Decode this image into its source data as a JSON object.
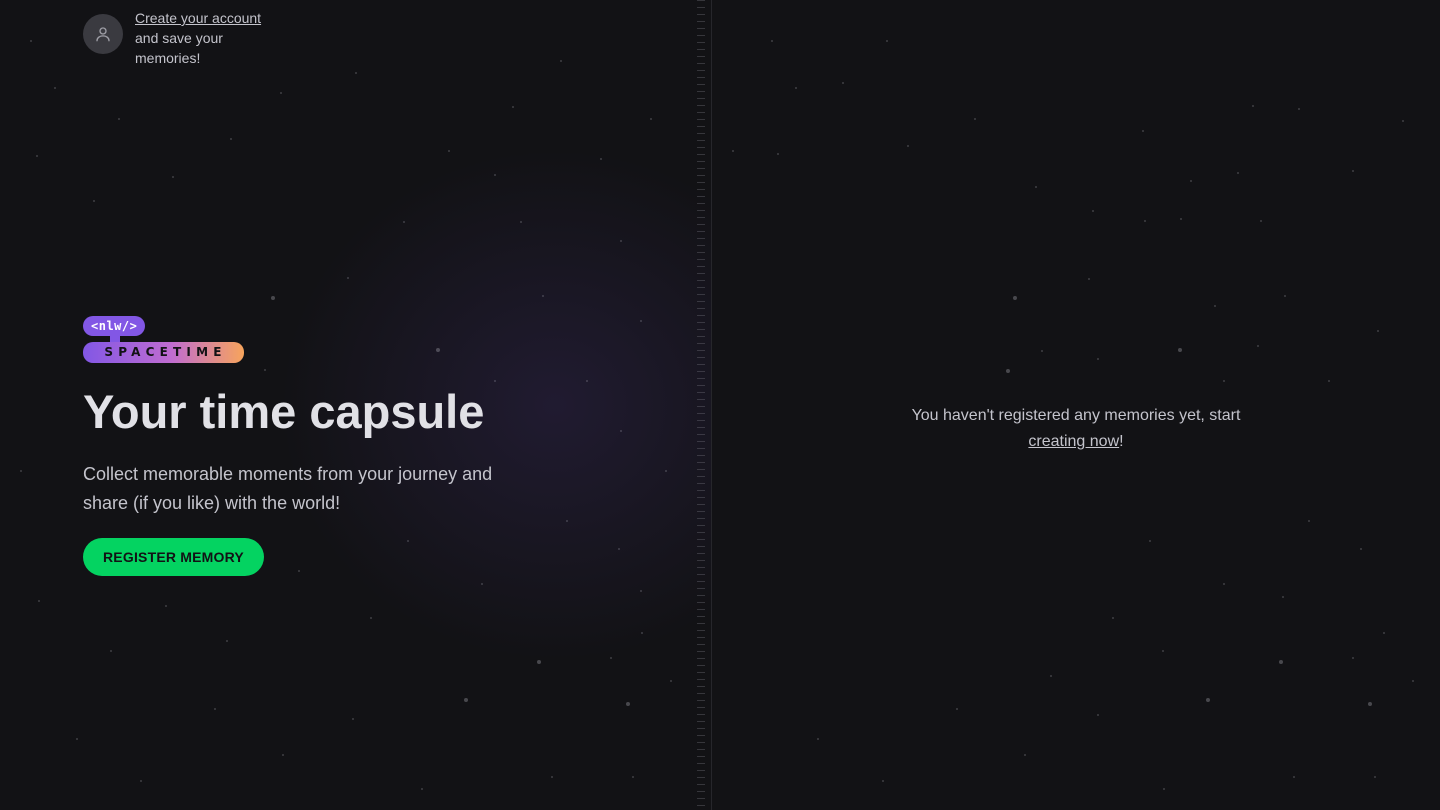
{
  "colors": {
    "background": "#121215",
    "cta": "#04d361",
    "brand_purple": "#8257e5",
    "brand_orange": "#f7a45c",
    "text_primary": "#e1e1e6",
    "text_secondary": "#c4c4cc"
  },
  "account": {
    "avatar_icon": "user-icon",
    "link_label": "Create your account",
    "description": "and save your memories!"
  },
  "logo": {
    "badge": "<nlw/>",
    "wordmark": "SPACETIME"
  },
  "hero": {
    "title": "Your time capsule",
    "subtitle": "Collect memorable moments from your journey and share (if you like) with the world!",
    "cta_label": "REGISTER MEMORY"
  },
  "empty_state": {
    "text": "You haven't registered any memories yet, start",
    "link_label": "creating now",
    "suffix": "!"
  }
}
